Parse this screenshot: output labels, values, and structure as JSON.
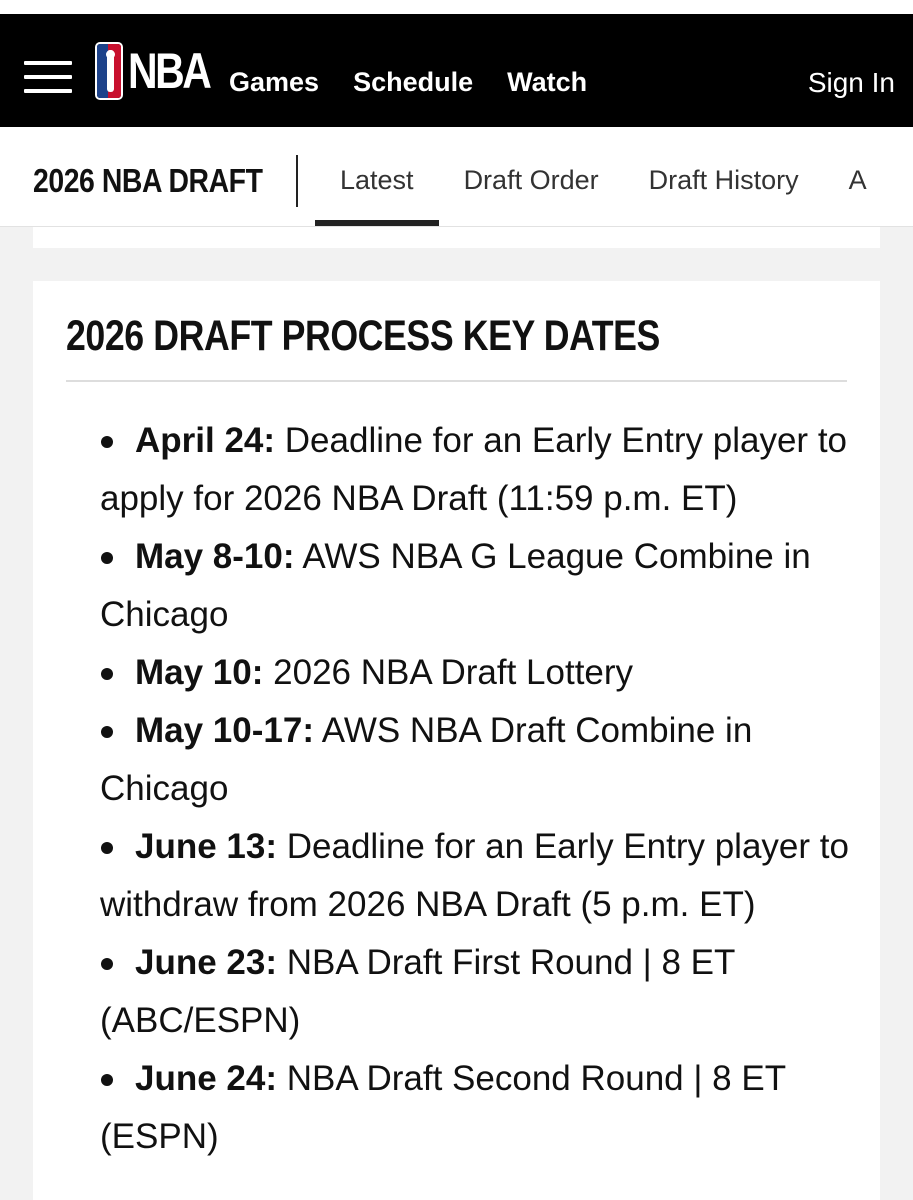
{
  "topnav": {
    "logo_text": "NBA",
    "links": [
      "Games",
      "Schedule",
      "Watch"
    ],
    "sign_in": "Sign In"
  },
  "subnav": {
    "title": "2026 NBA DRAFT",
    "tabs": [
      "Latest",
      "Draft Order",
      "Draft History",
      "A"
    ],
    "active_tab": "Latest"
  },
  "card": {
    "heading": "2026 DRAFT PROCESS KEY DATES",
    "items": [
      {
        "label": "April 24:",
        "text": "Deadline for an Early Entry player to apply for 2026 NBA Draft (11:59 p.m. ET)"
      },
      {
        "label": "May 8-10:",
        "text": "AWS NBA G League Combine in Chicago"
      },
      {
        "label": "May 10:",
        "text": "2026 NBA Draft Lottery"
      },
      {
        "label": "May 10-17:",
        "text": "AWS NBA Draft Combine in Chicago"
      },
      {
        "label": "June 13:",
        "text": "Deadline for an Early Entry player to withdraw from 2026 NBA Draft (5 p.m. ET)"
      },
      {
        "label": "June 23:",
        "text": "NBA Draft First Round | 8 ET (ABC/ESPN)"
      },
      {
        "label": "June 24:",
        "text": "NBA Draft Second Round | 8 ET (ESPN)"
      }
    ]
  },
  "colors": {
    "nav_bg": "#000000",
    "logo_blue": "#1d428a",
    "logo_red": "#c8102e",
    "page_bg": "#f2f2f2"
  }
}
